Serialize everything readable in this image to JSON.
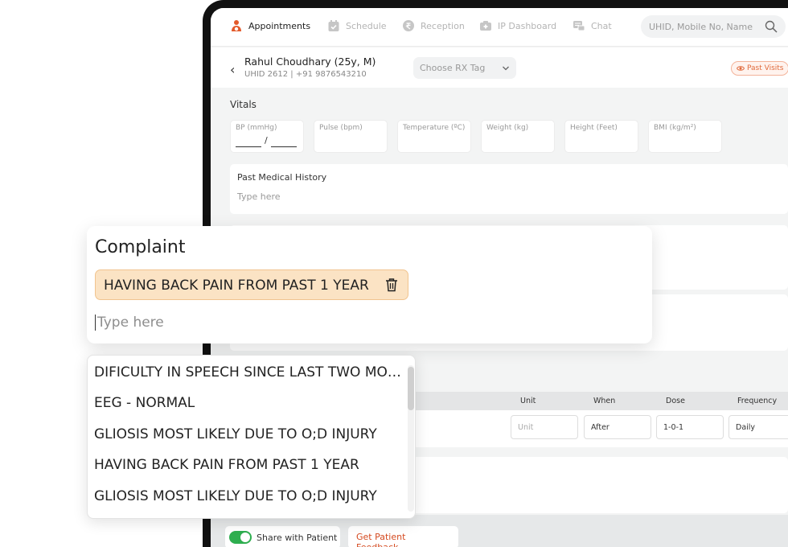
{
  "nav": {
    "items": [
      {
        "label": "Appointments",
        "icon": "appointments-icon",
        "active": true
      },
      {
        "label": "Schedule",
        "icon": "calendar-check-icon"
      },
      {
        "label": "Reception",
        "icon": "rupee-icon"
      },
      {
        "label": "IP Dashboard",
        "icon": "medical-cross-icon"
      },
      {
        "label": "Chat",
        "icon": "chat-icon"
      }
    ],
    "search_placeholder": "UHID, Mobile No, Name"
  },
  "patient": {
    "name": "Rahul Choudhary (25y, M)",
    "info": "UHID 2612  | +91 9876543210",
    "rx_tag_placeholder": "Choose RX Tag",
    "past_visits_label": "Past Visits"
  },
  "vitals": {
    "title": "Vitals",
    "fields": [
      {
        "label": "BP (mmHg)",
        "separator": "/"
      },
      {
        "label": "Pulse (bpm)"
      },
      {
        "label": "Temperature (ºC)"
      },
      {
        "label": "Weight (kg)"
      },
      {
        "label": "Height (Feet)"
      },
      {
        "label": "BMI (kg/m²)"
      }
    ]
  },
  "past_medical_history": {
    "title": "Past Medical History",
    "placeholder": "Type here"
  },
  "complaint": {
    "title": "Complaint",
    "chip": "HAVING BACK PAIN FROM PAST 1 YEAR",
    "input_placeholder": "Type here"
  },
  "suggestions": [
    "DIFICULTY IN SPEECH SINCE LAST TWO MONTHS",
    "EEG - NORMAL",
    "GLIOSIS MOST LIKELY DUE TO O;D INJURY",
    "HAVING BACK PAIN FROM PAST 1 YEAR",
    "GLIOSIS MOST LIKELY DUE TO O;D INJURY"
  ],
  "medicine_table": {
    "headers": [
      "Unit",
      "When",
      "Dose",
      "Frequency"
    ],
    "row": {
      "unit_placeholder": "Unit",
      "when": "After",
      "dose": "1-0-1",
      "frequency": "Daily"
    }
  },
  "footer": {
    "share_label": "Share with Patient",
    "share_enabled": true,
    "feedback_label": "Get Patient Feedback"
  },
  "colors": {
    "brand_orange": "#e35a2b",
    "chip_bg": "#fbe3c4",
    "toggle_green": "#2eae4f"
  }
}
